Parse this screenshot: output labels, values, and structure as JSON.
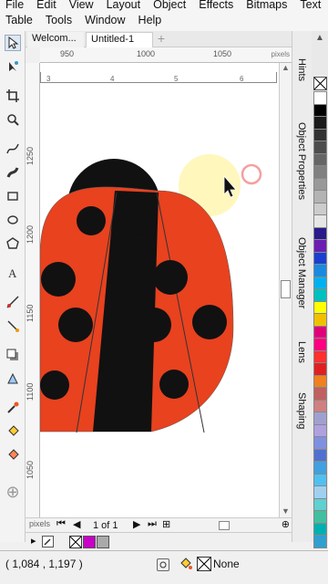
{
  "menubar": {
    "row1": [
      "File",
      "Edit",
      "View",
      "Layout",
      "Object",
      "Effects",
      "Bitmaps",
      "Text"
    ],
    "row2": [
      "Table",
      "Tools",
      "Window",
      "Help"
    ]
  },
  "tabs": [
    {
      "label": "Welcom..."
    },
    {
      "label": "Untitled-1"
    }
  ],
  "ruler": {
    "h_ticks": [
      "950",
      "1000",
      "1050"
    ],
    "h_small": [
      "3",
      "4",
      "5",
      "6"
    ],
    "units": "pixels",
    "v_ticks": [
      "1250",
      "1200",
      "1150",
      "1100",
      "1050"
    ]
  },
  "dockers": [
    "Hints",
    "Object Properties",
    "Object Manager",
    "Lens",
    "Shaping"
  ],
  "page_nav": {
    "pages": "1 of 1"
  },
  "status": {
    "coords": "( 1,084 , 1,197 )",
    "fill_label": "None"
  },
  "palette_colors": [
    "#ffffff",
    "#000000",
    "#1a1a1a",
    "#333333",
    "#4d4d4d",
    "#666666",
    "#808080",
    "#999999",
    "#b3b3b3",
    "#cccccc",
    "#e6e6e6",
    "#2a1a8a",
    "#6a1fb0",
    "#1a3fd0",
    "#1a8ae0",
    "#00b0f0",
    "#00c0c0",
    "#ffff00",
    "#f0c000",
    "#e0007a",
    "#ff0080",
    "#ff3030",
    "#e02020",
    "#f08020",
    "#c06060",
    "#d08080",
    "#a0a0d0",
    "#b0a0e0",
    "#8090e0",
    "#5070d0",
    "#40a0e0",
    "#50c0f0",
    "#a0d0f0",
    "#60d0d0",
    "#40c0a0",
    "#00b0b0",
    "#30a0d0"
  ],
  "colors": {
    "ladybug_red": "#e8421f",
    "ladybug_black": "#111111",
    "highlight": "#fff6b0",
    "accent": "#c800c8"
  }
}
